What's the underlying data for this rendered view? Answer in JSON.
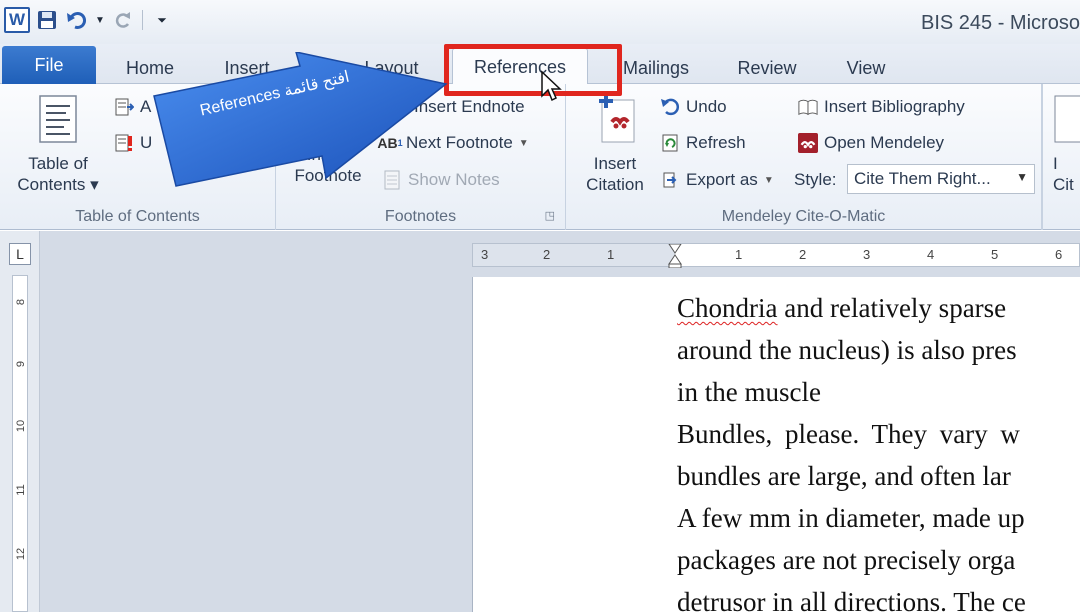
{
  "window": {
    "title": "BIS 245 - Microso"
  },
  "tabs": [
    {
      "label": "File"
    },
    {
      "label": "Home"
    },
    {
      "label": "Insert"
    },
    {
      "label": "Page Layout"
    },
    {
      "label": "References"
    },
    {
      "label": "Mailings"
    },
    {
      "label": "Review"
    },
    {
      "label": "View"
    }
  ],
  "callout": {
    "text": "References افتح قائمة"
  },
  "ribbon": {
    "toc": {
      "btn_line1": "Table of",
      "btn_line2": "Contents ▾",
      "add_text": "A",
      "update": "U",
      "group": "Table of Contents"
    },
    "footnotes": {
      "insert_line1": "Insert",
      "insert_line2": "Footnote",
      "insert_endnote": "Insert Endnote",
      "next_footnote": "Next Footnote",
      "show_notes": "Show Notes",
      "group": "Footnotes"
    },
    "mendeley": {
      "insert_line1": "Insert",
      "insert_line2": "Citation",
      "undo": "Undo",
      "refresh": "Refresh",
      "export_as": "Export as",
      "insert_bibliography": "Insert Bibliography",
      "open_mendeley": "Open Mendeley",
      "style_label": "Style:",
      "style_value": "Cite Them Right...",
      "group": "Mendeley Cite-O-Matic"
    },
    "partial": {
      "line1": "I",
      "line2": "Cit"
    }
  },
  "ruler": {
    "h_numbers": [
      "3",
      "2",
      "1",
      "1",
      "2",
      "3",
      "4",
      "5",
      "6"
    ],
    "v_numbers": [
      "8",
      "9",
      "10",
      "11",
      "12"
    ]
  },
  "document": {
    "lines": [
      {
        "first": "Chondria",
        "rest": " and relatively sparse"
      },
      {
        "first": "",
        "rest": "around the nucleus) is also pres"
      },
      {
        "first": "",
        "rest": "in the muscle"
      },
      {
        "first": "",
        "rest": "Bundles, please. They vary w"
      },
      {
        "first": "",
        "rest": "bundles are large, and often lar"
      },
      {
        "first": "",
        "rest": "A few mm in diameter, made up"
      },
      {
        "first": "",
        "rest": "packages are not precisely orga"
      },
      {
        "first": "",
        "rest": "detrusor in all directions. The ce"
      }
    ]
  },
  "colors": {
    "highlight": "#e0261e",
    "file_tab": "#2a66bf",
    "callout": "#1d5ec8"
  }
}
